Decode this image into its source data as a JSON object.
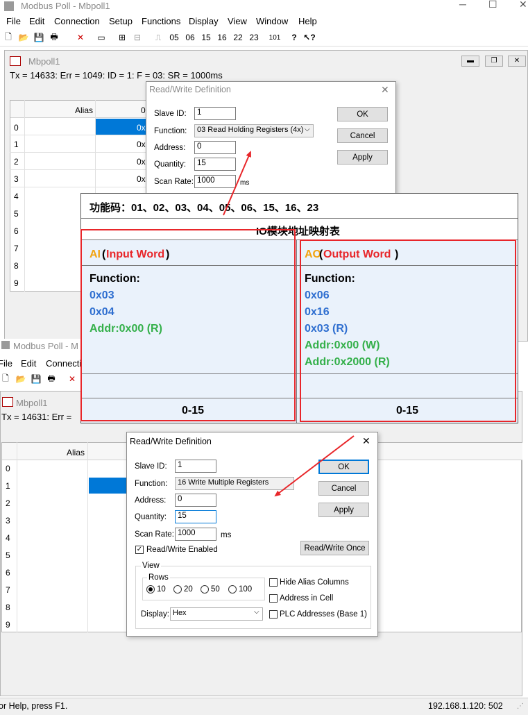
{
  "app": {
    "title": "Modbus Poll - Mbpoll1",
    "menu": [
      "File",
      "Edit",
      "Connection",
      "Setup",
      "Functions",
      "Display",
      "View",
      "Window",
      "Help"
    ],
    "toolbar_codes": [
      "05",
      "06",
      "15",
      "16",
      "22",
      "23",
      "101"
    ]
  },
  "win1": {
    "title": "Mbpoll1",
    "status": "Tx = 14633: Err = 1049: ID = 1: F = 03: SR = 1000ms",
    "alias_header": "Alias",
    "col_header": "0",
    "rows": [
      "0",
      "1",
      "2",
      "3",
      "4",
      "5",
      "6",
      "7",
      "8",
      "9"
    ],
    "cell_prefix": "0x"
  },
  "dlg1": {
    "title": "Read/Write Definition",
    "slave_label": "Slave ID:",
    "slave_value": "1",
    "function_label": "Function:",
    "function_value": "03 Read Holding Registers (4x)",
    "address_label": "Address:",
    "address_value": "0",
    "quantity_label": "Quantity:",
    "quantity_value": "15",
    "scan_label": "Scan Rate:",
    "scan_value": "1000",
    "scan_unit": "ms",
    "ok": "OK",
    "cancel": "Cancel",
    "apply": "Apply"
  },
  "overlay": {
    "function_codes": "功能码：01、02、03、04、05、06、15、16、23",
    "table_title": "IO模块地址映射表",
    "ai_prefix": "AI",
    "ai_label": "Input Word",
    "ao_prefix": "AO",
    "ao_label": "Output Word",
    "function_heading": "Function:",
    "ai_items": [
      "0x03",
      "0x04"
    ],
    "ai_addr": "Addr:0x00 (R)",
    "ao_items": [
      "0x06",
      "0x16",
      "0x03 (R)"
    ],
    "ao_addrs": [
      "Addr:0x00 (W)",
      "Addr:0x2000 (R)"
    ],
    "ai_range": "0-15",
    "ao_range": "0-15"
  },
  "win2": {
    "app_title": "Modbus Poll - M",
    "menu": [
      "File",
      "Edit",
      "Connecti"
    ],
    "title": "Mbpoll1",
    "status": "Tx = 14631: Err =",
    "alias_header": "Alias",
    "rows": [
      "0",
      "1",
      "2",
      "3",
      "4",
      "5",
      "6",
      "7",
      "8",
      "9"
    ]
  },
  "dlg2": {
    "title": "Read/Write Definition",
    "slave_label": "Slave ID:",
    "slave_value": "1",
    "function_label": "Function:",
    "function_value": "16 Write Multiple Registers",
    "address_label": "Address:",
    "address_value": "0",
    "quantity_label": "Quantity:",
    "quantity_value": "15",
    "scan_label": "Scan Rate:",
    "scan_value": "1000",
    "scan_unit": "ms",
    "enabled_label": "Read/Write Enabled",
    "view_label": "View",
    "rows_label": "Rows",
    "row_options": [
      "10",
      "20",
      "50",
      "100"
    ],
    "hide_alias": "Hide Alias Columns",
    "address_in_cell": "Address in Cell",
    "plc_addresses": "PLC Addresses (Base 1)",
    "display_label": "Display:",
    "display_value": "Hex",
    "ok": "OK",
    "cancel": "Cancel",
    "apply": "Apply",
    "once": "Read/Write Once"
  },
  "statusbar": {
    "help": "or Help, press F1.",
    "address": "192.168.1.120: 502"
  },
  "colors": {
    "accent_red": "#e8262a",
    "orange": "#f2a30f",
    "blue": "#2f6fd0",
    "green": "#34b04a",
    "panel_bg": "#eaf2fb",
    "select_blue": "#0078d7"
  }
}
